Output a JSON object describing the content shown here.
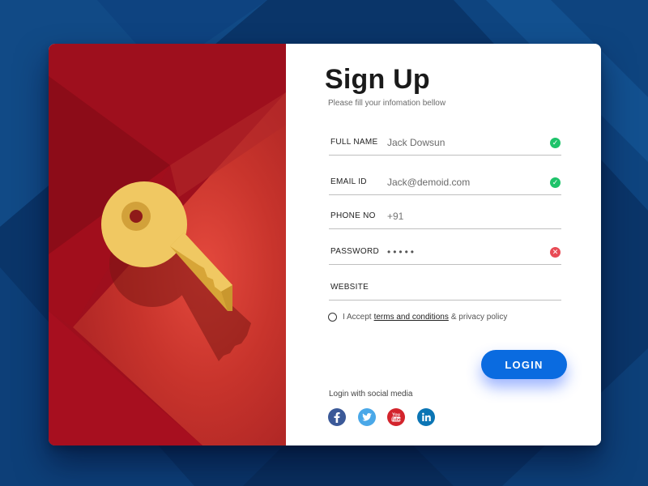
{
  "form": {
    "title": "Sign Up",
    "subtitle": "Please fill your infomation bellow",
    "fields": [
      {
        "label": "FULL NAME",
        "value": "Jack Dowsun",
        "placeholder": "",
        "status": "valid"
      },
      {
        "label": "EMAIL ID",
        "value": "Jack@demoid.com",
        "placeholder": "",
        "status": "valid"
      },
      {
        "label": "PHONE NO",
        "value": "",
        "placeholder": "+91",
        "status": "none"
      },
      {
        "label": "PASSWORD",
        "value": "•••••",
        "placeholder": "",
        "status": "invalid"
      },
      {
        "label": "WEBSITE",
        "value": "",
        "placeholder": "",
        "status": "none"
      }
    ],
    "terms": {
      "prefix": "I Accept",
      "link": "terms and conditions",
      "suffix": "& privacy policy",
      "checked": false
    },
    "login_label": "LOGIN",
    "social_label": "Login with social media",
    "socials": [
      {
        "name": "facebook",
        "icon": "facebook-icon",
        "color": "#3b5998"
      },
      {
        "name": "twitter",
        "icon": "twitter-icon",
        "color": "#4aa8e8"
      },
      {
        "name": "youtube",
        "icon": "youtube-icon",
        "color": "#d3242c"
      },
      {
        "name": "linkedin",
        "icon": "linkedin-icon",
        "color": "#0b75b4"
      }
    ]
  },
  "illustration": {
    "icon": "key-icon"
  },
  "colors": {
    "accent": "#0a6be0",
    "valid": "#1ec36a",
    "invalid": "#e84b55",
    "panel_red": "#c2302d",
    "key_yellow": "#f0c862",
    "background_blue": "#0b3a6e"
  }
}
